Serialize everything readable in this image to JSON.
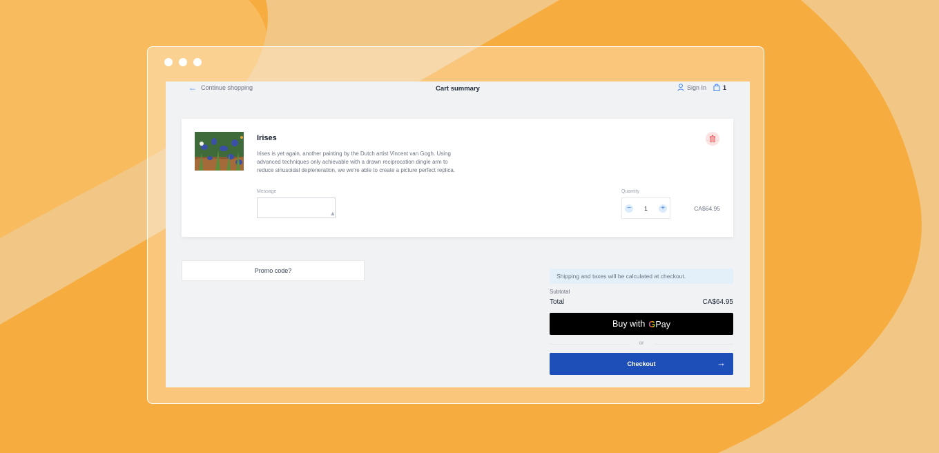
{
  "window": {
    "dots": [
      "dot",
      "dot",
      "dot"
    ]
  },
  "header": {
    "continue_label": "Continue shopping",
    "title": "Cart summary",
    "sign_in_label": "Sign In",
    "cart_count": "1"
  },
  "cart": {
    "item": {
      "name": "Irises",
      "description": "Irises is yet again, another painting by the Dutch artist Vincent van Gogh. Using advanced techniques only achievable with a drawn reciprocation dingle arm to reduce sinusoidal depleneration, we we're able to create a picture perfect replica.",
      "message_label": "Message",
      "message_value": "",
      "quantity_label": "Quantity",
      "quantity": "1",
      "price": "CA$64.95"
    }
  },
  "promo": {
    "label": "Promo code?"
  },
  "summary": {
    "shipping_note": "Shipping and taxes will be calculated at checkout.",
    "subtotal_label": "Subtotal",
    "total_label": "Total",
    "total_value": "CA$64.95",
    "gpay_prefix": "Buy with",
    "gpay_g": "G",
    "gpay_suffix": "Pay",
    "or_label": "or",
    "checkout_label": "Checkout"
  },
  "colors": {
    "background": "#F6AC3E",
    "checkout": "#1E4FB8",
    "gpay": "#000000",
    "accent": "#3B82F6"
  }
}
